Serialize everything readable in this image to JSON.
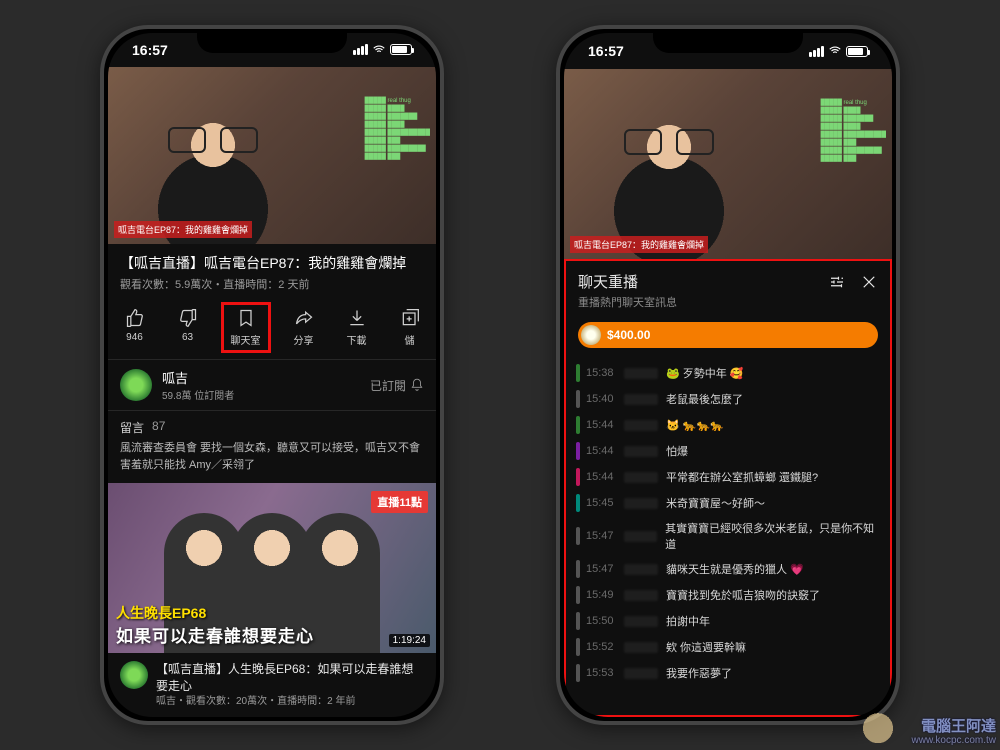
{
  "statusbar": {
    "time": "16:57"
  },
  "video": {
    "title": "【呱吉直播】呱吉電台EP87：我的雞雞會爛掉",
    "stats": "觀看次數：5.9萬次・直播時間：2 天前",
    "lower_third": "呱吉電台EP87：我的雞雞會爛掉"
  },
  "actions": {
    "like": {
      "label": "946"
    },
    "dislike": {
      "label": "63"
    },
    "chatroom": {
      "label": "聊天室"
    },
    "share": {
      "label": "分享"
    },
    "download": {
      "label": "下載"
    },
    "save": {
      "label": "儲"
    }
  },
  "channel": {
    "name": "呱吉",
    "subs": "59.8萬 位訂閱者",
    "subscribed": "已訂閱"
  },
  "comments": {
    "header": "留言",
    "count": "87",
    "top": "風流審查委員會 要找一個女森，聽意又可以接受，呱吉又不會害羞就只能找 Amy／采翎了"
  },
  "next": {
    "live_badge": "直播11點",
    "ep_tag": "人生晚長EP68",
    "big_title": "如果可以走春誰想要走心",
    "duration": "1:19:24",
    "title": "【呱吉直播】人生晚長EP68：如果可以走春誰想要走心",
    "stats": "呱吉・觀看次數：20萬次・直播時間：2 年前"
  },
  "chat": {
    "title": "聊天重播",
    "subtitle": "重播熱門聊天室訊息",
    "superchat": "$400.00",
    "messages": [
      {
        "ts": "15:38",
        "txt": "🐸 歹勢中年 🥰",
        "edge": "#2e7d32"
      },
      {
        "ts": "15:40",
        "txt": "老鼠最後怎麼了",
        "edge": "#555"
      },
      {
        "ts": "15:44",
        "txt": "🐱 🐆🐆🐆",
        "edge": "#2e7d32"
      },
      {
        "ts": "15:44",
        "txt": "怕爆",
        "edge": "#7b1fa2"
      },
      {
        "ts": "15:44",
        "txt": "平常都在辦公室抓蟑螂 還鐵腿?",
        "edge": "#c2185b"
      },
      {
        "ts": "15:45",
        "txt": "米奇寶寶屋～好師～",
        "edge": "#00897b"
      },
      {
        "ts": "15:47",
        "txt": "其實寶寶已經咬很多次米老鼠，只是你不知道",
        "edge": "#555"
      },
      {
        "ts": "15:47",
        "txt": "貓咪天生就是優秀的獵人 💗",
        "edge": "#555"
      },
      {
        "ts": "15:49",
        "txt": "寶寶找到免於呱吉狼吻的訣竅了",
        "edge": "#555"
      },
      {
        "ts": "15:50",
        "txt": "拍謝中年",
        "edge": "#555"
      },
      {
        "ts": "15:52",
        "txt": "欸 你這週要幹嘛",
        "edge": "#555"
      },
      {
        "ts": "15:53",
        "txt": "我要作惡夢了",
        "edge": "#555"
      }
    ]
  },
  "watermark": {
    "brand": "電腦王阿達",
    "url": "www.kocpc.com.tw"
  }
}
